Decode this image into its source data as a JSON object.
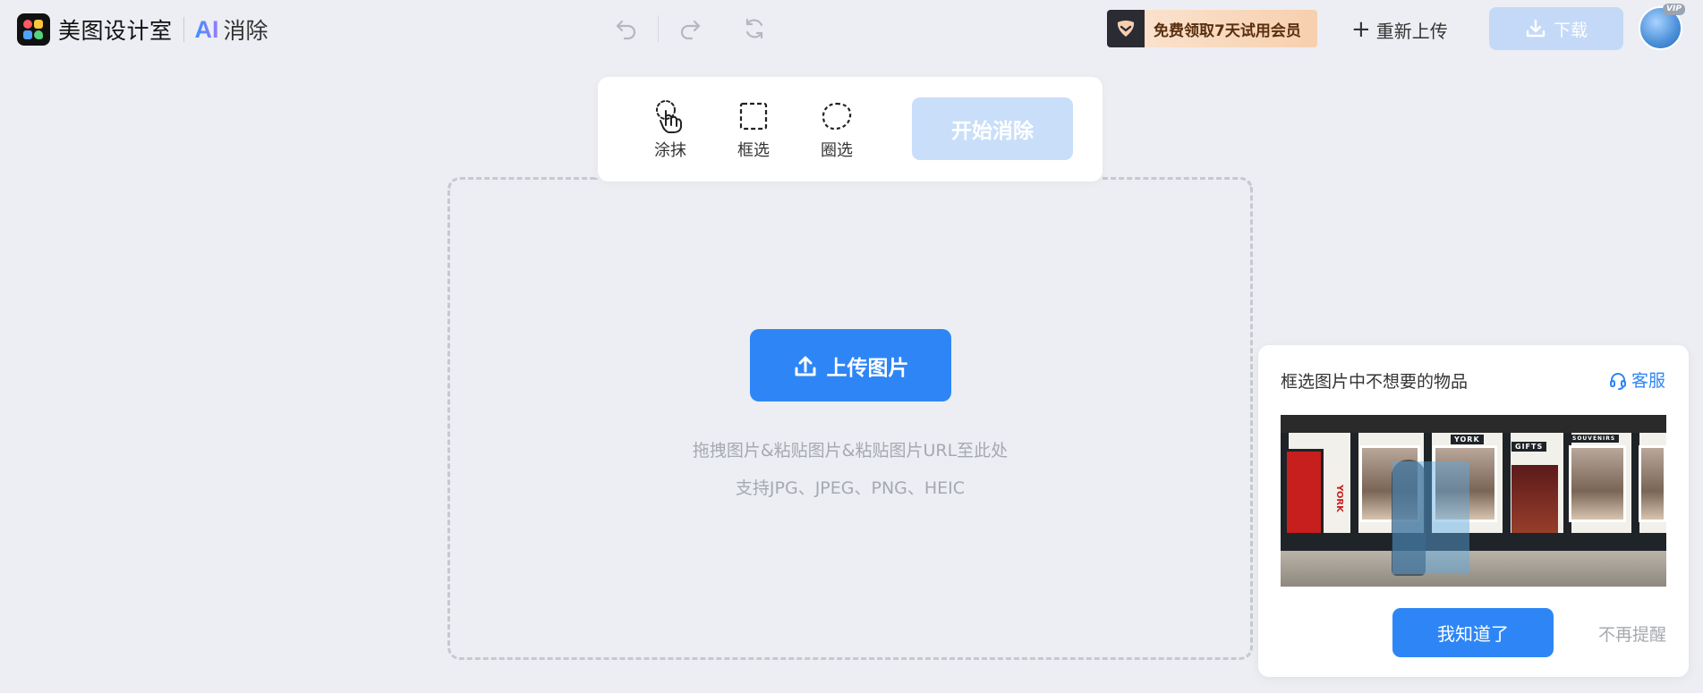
{
  "header": {
    "app_name": "美图设计室",
    "ai_label": "AI",
    "product_name": "消除",
    "promo_text": "免费领取7天试用会员",
    "reupload_label": "重新上传",
    "download_label": "下载",
    "vip_badge": "VIP"
  },
  "toolbar": {
    "tools": [
      {
        "label": "涂抹",
        "icon": "smear-hand-icon"
      },
      {
        "label": "框选",
        "icon": "rect-select-icon"
      },
      {
        "label": "圈选",
        "icon": "lasso-select-icon"
      }
    ],
    "start_label": "开始消除"
  },
  "upload": {
    "button_label": "上传图片",
    "hint_line1": "拖拽图片&粘贴图片&粘贴图片URL至此处",
    "hint_line2": "支持JPG、JPEG、PNG、HEIC"
  },
  "guide": {
    "title": "框选图片中不想要的物品",
    "support_label": "客服",
    "image_signs": [
      "YORK",
      "GIFTS",
      "SOUVENIRS"
    ],
    "confirm_label": "我知道了",
    "dismiss_label": "不再提醒"
  },
  "colors": {
    "primary": "#2e86f6",
    "primary_disabled": "#c9def9",
    "background": "#eceef3"
  }
}
